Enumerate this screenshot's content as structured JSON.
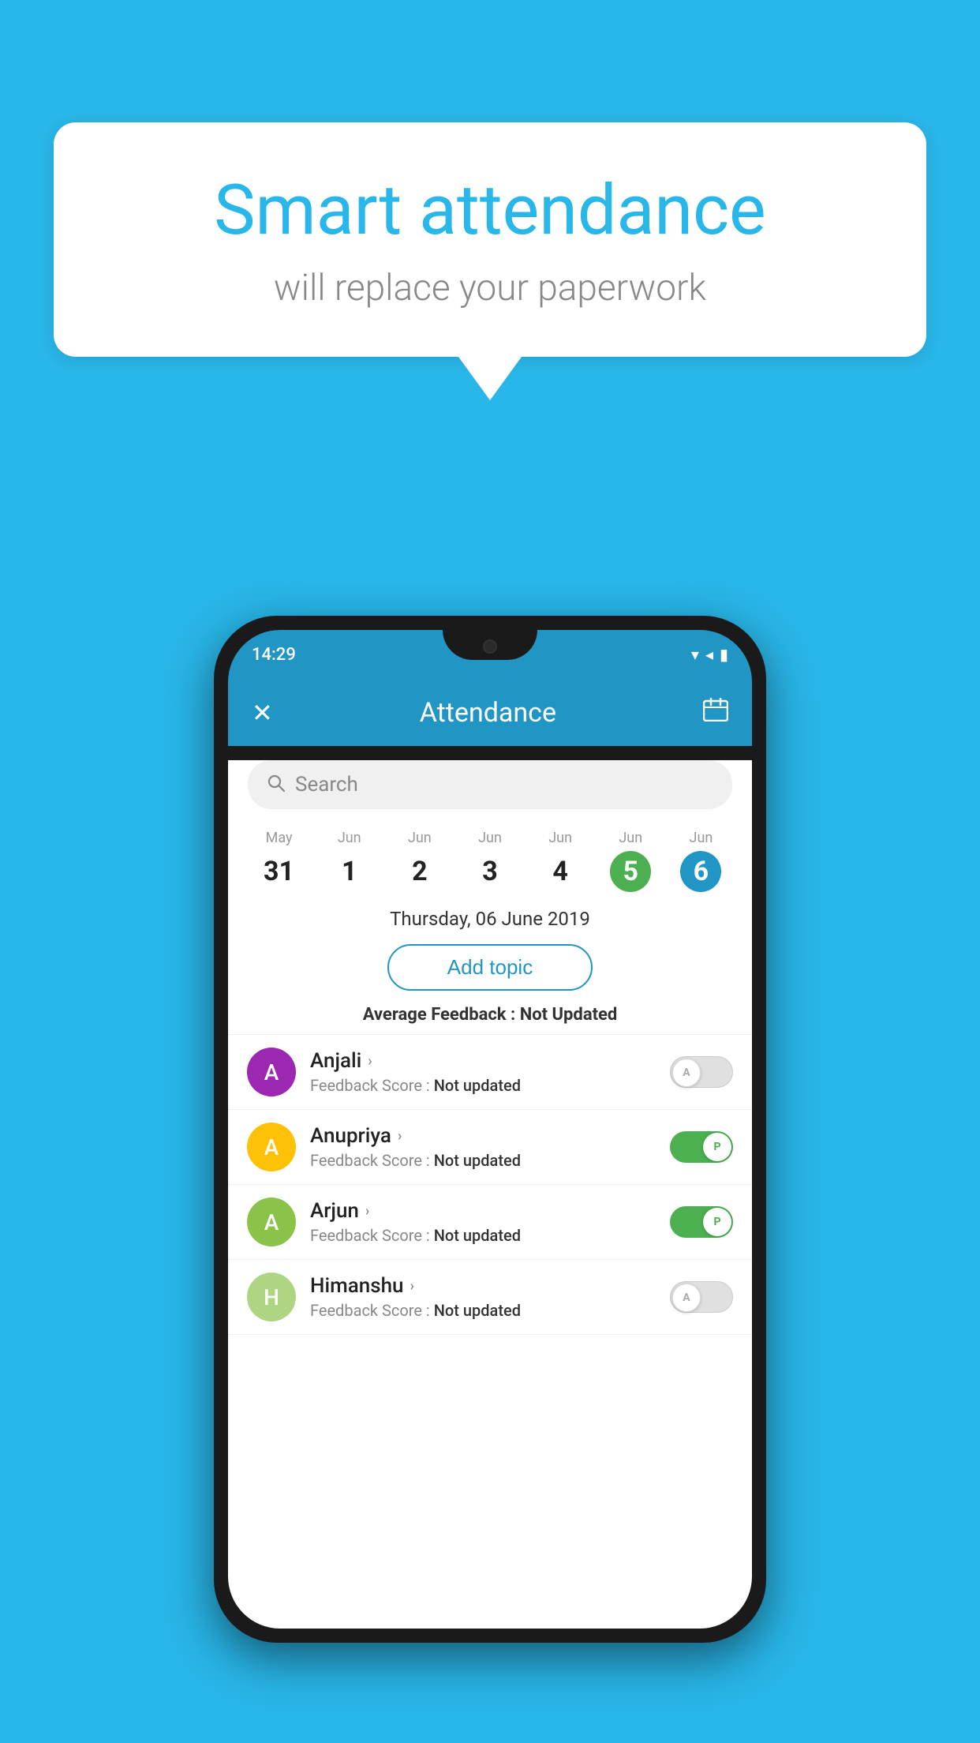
{
  "background_color": "#29b6e8",
  "speech_bubble": {
    "heading": "Smart attendance",
    "subtext": "will replace your paperwork"
  },
  "phone": {
    "status_bar": {
      "time": "14:29",
      "wifi": "▾",
      "signal": "▲",
      "battery": "▮"
    },
    "header": {
      "close_label": "✕",
      "title": "Attendance",
      "calendar_icon": "📅"
    },
    "search": {
      "placeholder": "Search"
    },
    "calendar": {
      "days": [
        {
          "month": "May",
          "num": "31",
          "state": "normal"
        },
        {
          "month": "Jun",
          "num": "1",
          "state": "normal"
        },
        {
          "month": "Jun",
          "num": "2",
          "state": "normal"
        },
        {
          "month": "Jun",
          "num": "3",
          "state": "normal"
        },
        {
          "month": "Jun",
          "num": "4",
          "state": "normal"
        },
        {
          "month": "Jun",
          "num": "5",
          "state": "today"
        },
        {
          "month": "Jun",
          "num": "6",
          "state": "selected"
        }
      ]
    },
    "selected_date": "Thursday, 06 June 2019",
    "add_topic_label": "Add topic",
    "average_feedback": {
      "label": "Average Feedback : ",
      "value": "Not Updated"
    },
    "students": [
      {
        "name": "Anjali",
        "avatar_letter": "A",
        "avatar_color": "#9c27b0",
        "feedback_label": "Feedback Score : ",
        "feedback_value": "Not updated",
        "toggle": "off",
        "toggle_letter": "A"
      },
      {
        "name": "Anupriya",
        "avatar_letter": "A",
        "avatar_color": "#ffc107",
        "feedback_label": "Feedback Score : ",
        "feedback_value": "Not updated",
        "toggle": "on",
        "toggle_letter": "P"
      },
      {
        "name": "Arjun",
        "avatar_letter": "A",
        "avatar_color": "#8bc34a",
        "feedback_label": "Feedback Score : ",
        "feedback_value": "Not updated",
        "toggle": "on",
        "toggle_letter": "P"
      },
      {
        "name": "Himanshu",
        "avatar_letter": "H",
        "avatar_color": "#aed581",
        "feedback_label": "Feedback Score : ",
        "feedback_value": "Not updated",
        "toggle": "off",
        "toggle_letter": "A"
      }
    ]
  }
}
